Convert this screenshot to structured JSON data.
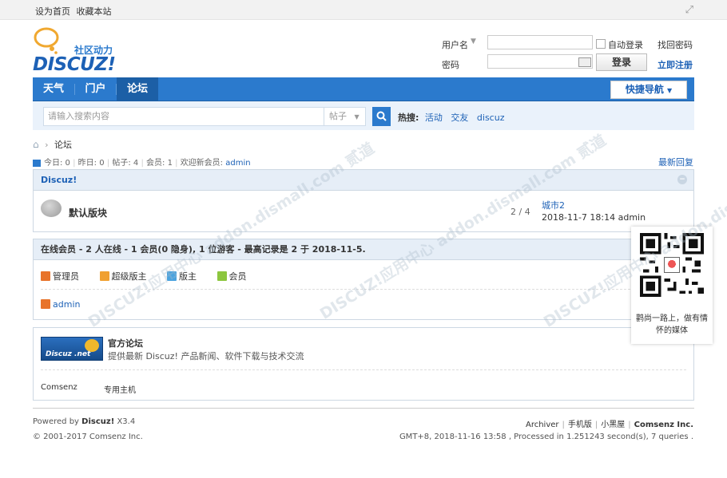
{
  "topbar": {
    "set_home": "设为首页",
    "favorite": "收藏本站"
  },
  "logo": {
    "slogan": "社区动力",
    "wordmark": "DISCUZ!"
  },
  "login": {
    "username_label": "用户名",
    "password_label": "密码",
    "auto_login": "自动登录",
    "find_password": "找回密码",
    "login_button": "登录",
    "register": "立即注册"
  },
  "nav": {
    "items": [
      {
        "label": "天气"
      },
      {
        "label": "门户"
      },
      {
        "label": "论坛"
      }
    ],
    "quick_nav": "快捷导航"
  },
  "search": {
    "placeholder": "请输入搜索内容",
    "type": "帖子",
    "hot_label": "热搜:",
    "hot_words": [
      "活动",
      "交友",
      "discuz"
    ]
  },
  "breadcrumb": {
    "current": "论坛"
  },
  "stats": {
    "today": "今日: 0",
    "yesterday": "昨日: 0",
    "posts": "帖子: 4",
    "members": "会员: 1",
    "welcome": "欢迎新会员:",
    "new_member": "admin",
    "latest_reply": "最新回复"
  },
  "forum_group": {
    "title": "Discuz!",
    "forum": {
      "name": "默认版块",
      "counts": "2 / 4",
      "last_thread": "城市2",
      "last_meta": "2018-11-7 18:14 admin"
    }
  },
  "online": {
    "title": "在线会员 - 2 人在线 - 1 会员(0 隐身), 1 位游客 - 最高记录是 2 于 2018-11-5.",
    "legend": [
      {
        "label": "管理员",
        "color": "#e8732a"
      },
      {
        "label": "超级版主",
        "color": "#f0a030"
      },
      {
        "label": "版主",
        "color": "#4aa3df"
      },
      {
        "label": "会员",
        "color": "#8cc63f"
      }
    ],
    "member": "admin"
  },
  "links": {
    "logo_text": "Discuz .net",
    "title": "官方论坛",
    "desc": "提供最新 Discuz! 产品新闻、软件下载与技术交流",
    "partner1": "Comsenz",
    "partner2": "专用主机"
  },
  "footer": {
    "powered_prefix": "Powered by",
    "powered_name": "Discuz!",
    "version": "X3.4",
    "copyright": "© 2001-2017 Comsenz Inc.",
    "links": [
      "Archiver",
      "手机版",
      "小黑屋"
    ],
    "company": "Comsenz Inc.",
    "timing": "GMT+8, 2018-11-16 13:58 , Processed in 1.251243 second(s), 7 queries ."
  },
  "qr": {
    "caption": "鹳尚一路上，做有情怀的媒体"
  },
  "watermark": "DISCUZ!应用中心 addon.dismall.com 贰道"
}
